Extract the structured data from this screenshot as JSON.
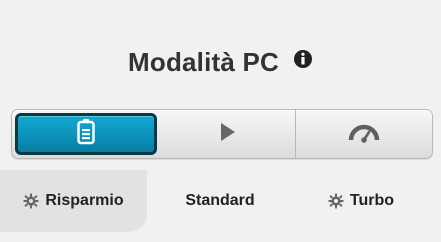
{
  "panel": {
    "title": "Modalità PC",
    "info_icon": "info-icon"
  },
  "modes": {
    "selected_index": 0,
    "buttons": [
      {
        "icon": "battery-icon"
      },
      {
        "icon": "play-icon"
      },
      {
        "icon": "speedometer-icon"
      }
    ],
    "labels": [
      {
        "text": "Risparmio",
        "icon": "gear-icon"
      },
      {
        "text": "Standard",
        "icon": ""
      },
      {
        "text": "Turbo",
        "icon": "gear-icon"
      }
    ]
  },
  "colors": {
    "active_blue": "#0a9cc6",
    "active_border": "#0a3946",
    "icon_gray": "#676767",
    "text": "#222222"
  }
}
